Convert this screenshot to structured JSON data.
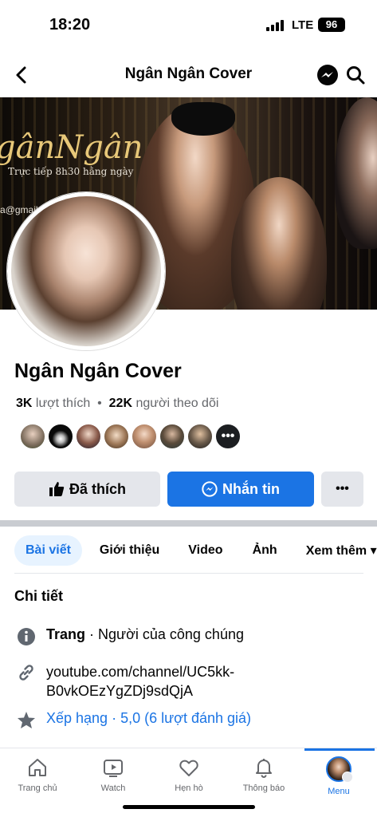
{
  "status_bar": {
    "time": "18:20",
    "network": "LTE",
    "battery": "96"
  },
  "header": {
    "title": "Ngân Ngân Cover"
  },
  "cover": {
    "brand_text": "gânNgân",
    "subtitle": "Trực tiếp 8h30 hằng ngày",
    "email_fragment": "a@gmail.c"
  },
  "page": {
    "name": "Ngân Ngân Cover",
    "likes_count": "3K",
    "likes_label": "lượt thích",
    "followers_count": "22K",
    "followers_label": "người theo dõi",
    "friends_more": "•••"
  },
  "actions": {
    "liked_label": "Đã thích",
    "message_label": "Nhắn tin",
    "more_label": "•••"
  },
  "tabs": [
    {
      "label": "Bài viết"
    },
    {
      "label": "Giới thiệu"
    },
    {
      "label": "Video"
    },
    {
      "label": "Ảnh"
    },
    {
      "label": "Xem thêm ▾"
    }
  ],
  "details": {
    "title": "Chi tiết",
    "category_bold": "Trang",
    "category_rest": " · Người của công chúng",
    "link": "youtube.com/channel/UC5kk-B0vkOEzYgZDj9sdQjA",
    "rating": "Xếp hạng · 5,0 (6 lượt đánh giá)"
  },
  "bottom_nav": [
    {
      "label": "Trang chủ",
      "icon": "home-icon"
    },
    {
      "label": "Watch",
      "icon": "watch-icon"
    },
    {
      "label": "Hẹn hò",
      "icon": "dating-heart-icon"
    },
    {
      "label": "Thông báo",
      "icon": "bell-icon"
    },
    {
      "label": "Menu",
      "icon": "profile-avatar"
    }
  ],
  "colors": {
    "accent": "#1b74e4",
    "button_gray": "#e4e6eb",
    "text_secondary": "#65676b"
  }
}
